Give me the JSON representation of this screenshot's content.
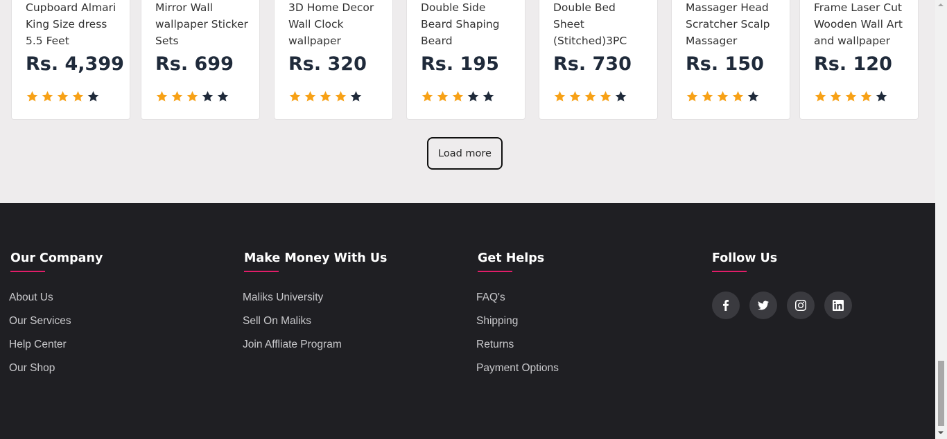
{
  "products": [
    {
      "name": "Cupboard Almari King Size dress 5.5 Feet",
      "price": "Rs. 4,399",
      "rating": 4
    },
    {
      "name": "Mirror Wall wallpaper Sticker Sets",
      "price": "Rs. 699",
      "rating": 3
    },
    {
      "name": "3D Home Decor Wall Clock wallpaper",
      "price": "Rs. 320",
      "rating": 4
    },
    {
      "name": "Double Side Beard Shaping Beard",
      "price": "Rs. 195",
      "rating": 3
    },
    {
      "name": "Double Bed Sheet (Stitched)3PC",
      "price": "Rs. 730",
      "rating": 4
    },
    {
      "name": "Massager Head Scratcher Scalp Massager",
      "price": "Rs. 150",
      "rating": 4
    },
    {
      "name": "Frame Laser Cut Wooden Wall Art and wallpaper",
      "price": "Rs. 120",
      "rating": 4
    }
  ],
  "load_more_label": "Load more",
  "colors": {
    "star_filled": "#f7a116",
    "star_empty": "#1f2a3a",
    "accent": "#e11d69",
    "footer_bg": "#1f1f23"
  },
  "footer": {
    "company": {
      "title": "Our Company",
      "links": [
        "About Us",
        "Our Services",
        "Help Center",
        "Our Shop"
      ]
    },
    "money": {
      "title": "Make Money With Us",
      "links": [
        "Maliks University",
        "Sell On Maliks",
        "Join Affliate Program"
      ]
    },
    "help": {
      "title": "Get Helps",
      "links": [
        "FAQ's",
        "Shipping",
        "Returns",
        "Payment Options"
      ]
    },
    "follow": {
      "title": "Follow Us",
      "icons": [
        "facebook-icon",
        "twitter-icon",
        "instagram-icon",
        "linkedin-icon"
      ]
    }
  }
}
